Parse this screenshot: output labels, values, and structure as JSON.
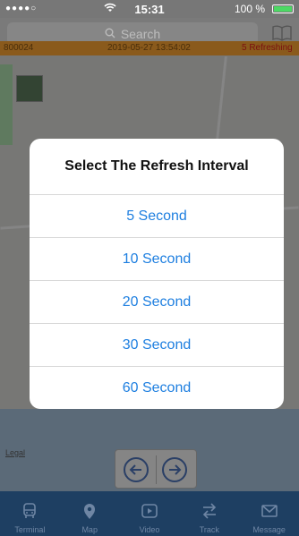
{
  "status_bar": {
    "signal": "●●●●○",
    "time": "15:31",
    "battery": "100 %"
  },
  "search": {
    "placeholder": "Search"
  },
  "info_bar": {
    "vehicle_id": "800024",
    "timestamp": "2019-05-27 13:54:02",
    "refresh": "5 Refreshing"
  },
  "map": {
    "legal": "Legal"
  },
  "dialog": {
    "title": "Select The Refresh Interval",
    "options": [
      "5 Second",
      "10 Second",
      "20 Second",
      "30 Second",
      "60 Second"
    ]
  },
  "tabs": [
    {
      "label": "Terminal",
      "icon": "bus-icon"
    },
    {
      "label": "Map",
      "icon": "map-pin-icon"
    },
    {
      "label": "Video",
      "icon": "play-icon"
    },
    {
      "label": "Track",
      "icon": "swap-arrows-icon"
    },
    {
      "label": "Message",
      "icon": "envelope-icon"
    }
  ],
  "colors": {
    "accent": "#1e7fe0",
    "tab_bar": "#1e3f62",
    "info_bar": "#8a5a1c"
  }
}
